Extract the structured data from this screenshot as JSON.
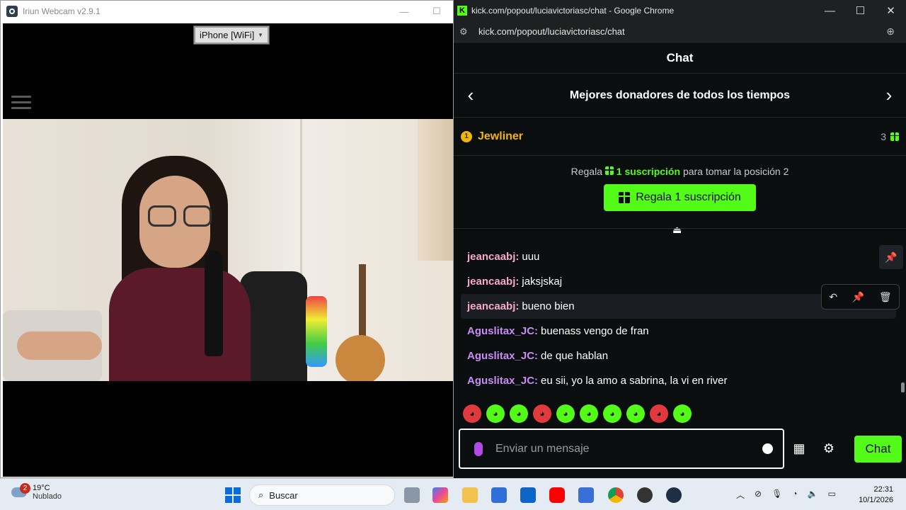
{
  "iriun": {
    "title": "Iriun Webcam v2.9.1",
    "minimize": "—",
    "maximize": "☐",
    "device": "iPhone [WiFi]"
  },
  "chrome": {
    "title": "kick.com/popout/luciavictoriasc/chat - Google Chrome",
    "url": "kick.com/popout/luciavictoriasc/chat",
    "minimize": "—",
    "maximize": "☐",
    "close": "✕"
  },
  "chat": {
    "header": "Chat",
    "leaderboard_title": "Mejores donadores de todos los tiempos",
    "top_donor": {
      "rank": "1",
      "name": "Jewliner",
      "count": "3"
    },
    "gift_prompt": {
      "prefix": "Regala",
      "highlight": "1 suscripción",
      "suffix": "para tomar la posición 2"
    },
    "gift_button": "Regala 1 suscripción",
    "messages": [
      {
        "user": "jeancaabj:",
        "text": "uuu",
        "color": "#f7a9c9"
      },
      {
        "user": "jeancaabj:",
        "text": "jaksjskaj",
        "color": "#f7a9c9"
      },
      {
        "user": "jeancaabj:",
        "text": "bueno bien",
        "color": "#f7a9c9"
      },
      {
        "user": "Aguslitax_JC:",
        "text": "buenass vengo de fran",
        "color": "#c98cf7"
      },
      {
        "user": "Aguslitax_JC:",
        "text": "de que hablan",
        "color": "#c98cf7"
      },
      {
        "user": "Aguslitax_JC:",
        "text": "eu sii, yo la amo a sabrina, la vi en river",
        "color": "#c98cf7"
      }
    ],
    "emotes": [
      "#e0393e",
      "#53fc18",
      "#53fc18",
      "#e0393e",
      "#53fc18",
      "#53fc18",
      "#53fc18",
      "#53fc18",
      "#e0393e",
      "#53fc18"
    ],
    "input_placeholder": "Enviar un mensaje",
    "send_button": "Chat"
  },
  "taskbar": {
    "notifications": "2",
    "temperature": "19°C",
    "condition": "Nublado",
    "search_placeholder": "Buscar",
    "time": "22:31",
    "date": "10/1/2026"
  },
  "colors": {
    "kick_green": "#53fc18",
    "donor_gold": "#f2b705"
  }
}
